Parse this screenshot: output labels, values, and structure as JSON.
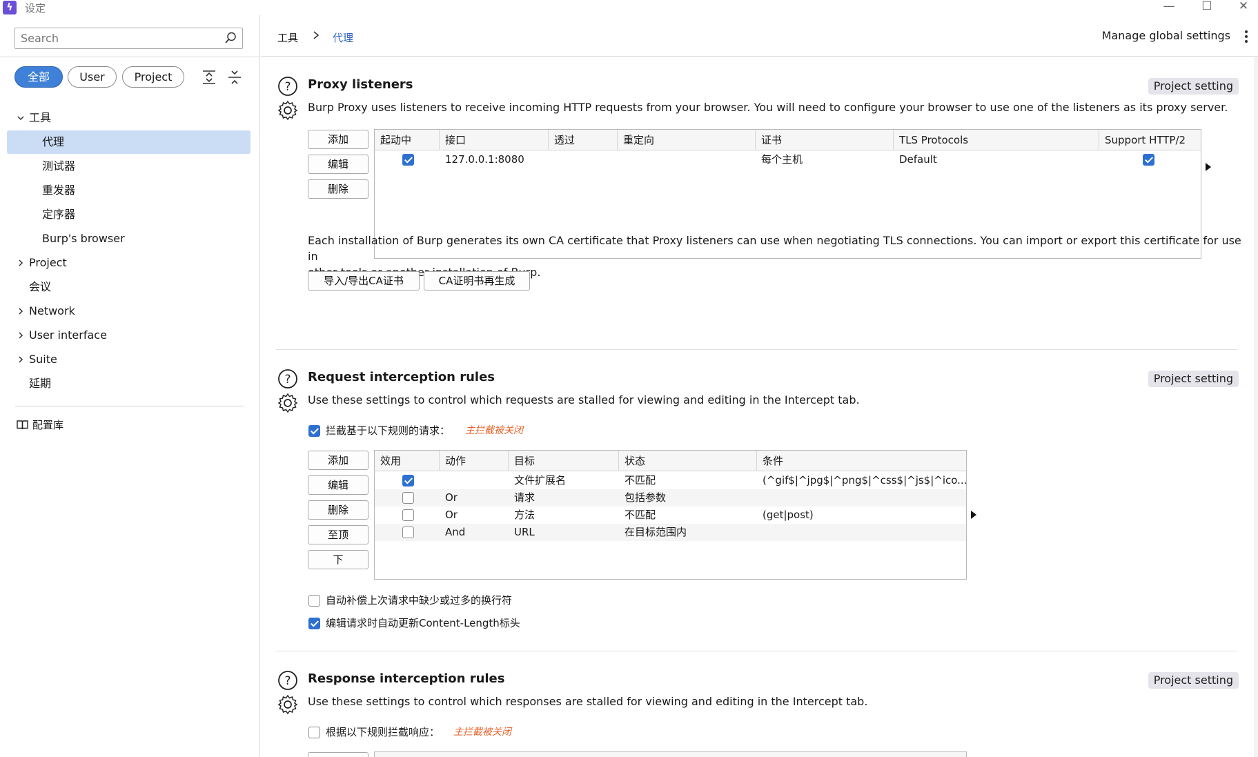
{
  "window": {
    "title": "设定"
  },
  "sidebar": {
    "search_placeholder": "Search",
    "filters": [
      {
        "label": "全部",
        "active": true
      },
      {
        "label": "User",
        "active": false
      },
      {
        "label": "Project",
        "active": false
      }
    ],
    "tree": {
      "tools": "工具",
      "proxy": "代理",
      "intruder": "测试器",
      "repeater": "重发器",
      "sequencer": "定序器",
      "burps_browser": "Burp's browser",
      "project": "Project",
      "sessions": "会议",
      "network": "Network",
      "user_interface": "User interface",
      "suite": "Suite",
      "extensions": "延期"
    },
    "library": "配置库"
  },
  "breadcrumb": {
    "root": "工具",
    "current": "代理"
  },
  "header": {
    "manage_global": "Manage global settings"
  },
  "proxy_listeners": {
    "title": "Proxy listeners",
    "tag": "Project setting",
    "description": "Burp Proxy uses listeners to receive incoming HTTP requests from your browser. You will need to configure your browser to use one of the listeners as its proxy server.",
    "buttons": {
      "add": "添加",
      "edit": "编辑",
      "remove": "删除"
    },
    "columns": [
      "起动中",
      "接口",
      "透过",
      "重定向",
      "证书",
      "TLS Protocols",
      "Support HTTP/2"
    ],
    "rows": [
      {
        "running": true,
        "interface": "127.0.0.1:8080",
        "invisible": "",
        "redirect": "",
        "certificate": "每个主机",
        "tls": "Default",
        "http2": true
      }
    ],
    "ca_text_1": "Each installation of Burp generates its own CA certificate that Proxy listeners can use when negotiating TLS connections. You can import or export this certificate for use in",
    "ca_text_2": "other tools or another installation of Burp.",
    "ca_buttons": {
      "import_export": "导入/导出CA证书",
      "regenerate": "CA证明书再生成"
    }
  },
  "request_rules": {
    "title": "Request interception rules",
    "tag": "Project setting",
    "description": "Use these settings to control which requests are stalled for viewing and editing in the Intercept tab.",
    "intercept_label": "拦截基于以下规则的请求：",
    "intercept_checked": true,
    "intercept_note": "主拦截被关闭",
    "buttons": {
      "add": "添加",
      "edit": "编辑",
      "remove": "删除",
      "up": "至顶",
      "down": "下"
    },
    "columns": [
      "效用",
      "动作",
      "目标",
      "状态",
      "条件"
    ],
    "rows": [
      {
        "enabled": true,
        "op": "",
        "match": "文件扩展名",
        "relation": "不匹配",
        "condition": "(^gif$|^jpg$|^png$|^css$|^js$|^ico..."
      },
      {
        "enabled": false,
        "op": "Or",
        "match": "请求",
        "relation": "包括参数",
        "condition": ""
      },
      {
        "enabled": false,
        "op": "Or",
        "match": "方法",
        "relation": "不匹配",
        "condition": "(get|post)"
      },
      {
        "enabled": false,
        "op": "And",
        "match": "URL",
        "relation": "在目标范围内",
        "condition": ""
      }
    ],
    "opt_fix_newlines": "自动补偿上次请求中缺少或过多的换行符",
    "opt_fix_newlines_checked": false,
    "opt_update_length": "编辑请求时自动更新Content-Length标头",
    "opt_update_length_checked": true
  },
  "response_rules": {
    "title": "Response interception rules",
    "tag": "Project setting",
    "description": "Use these settings to control which responses are stalled for viewing and editing in the Intercept tab.",
    "intercept_label": "根据以下规则拦截响应：",
    "intercept_checked": false,
    "intercept_note": "主拦截被关闭"
  },
  "colors": {
    "accent": "#3f80d8",
    "selected": "#cbdcf5",
    "note": "#e5642c",
    "link": "#2e63c0"
  }
}
